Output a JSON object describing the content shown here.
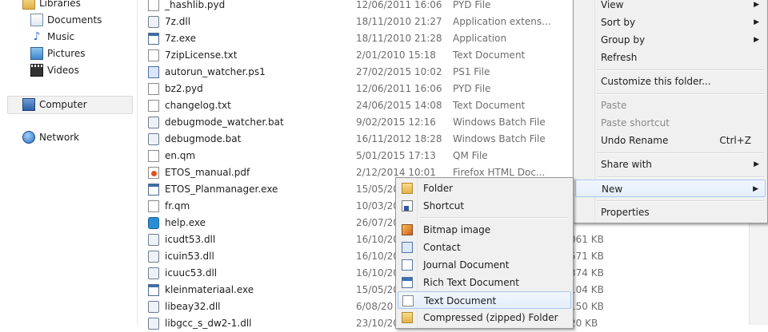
{
  "navigation": {
    "libraries": "Libraries",
    "library_items": [
      {
        "label": "Documents",
        "icon": "documents-icon"
      },
      {
        "label": "Music",
        "icon": "music-icon"
      },
      {
        "label": "Pictures",
        "icon": "pictures-icon"
      },
      {
        "label": "Videos",
        "icon": "videos-icon"
      }
    ],
    "computer": "Computer",
    "network": "Network"
  },
  "files": [
    {
      "name": "_hashlib.pyd",
      "date": "12/06/2011 16:06",
      "type": "PYD File",
      "size": ""
    },
    {
      "name": "7z.dll",
      "date": "18/11/2010 21:27",
      "type": "Application extens...",
      "size": ""
    },
    {
      "name": "7z.exe",
      "date": "18/11/2010 21:28",
      "type": "Application",
      "size": ""
    },
    {
      "name": "7zipLicense.txt",
      "date": "2/01/2010 15:18",
      "type": "Text Document",
      "size": ""
    },
    {
      "name": "autorun_watcher.ps1",
      "date": "27/02/2015 10:02",
      "type": "PS1 File",
      "size": ""
    },
    {
      "name": "bz2.pyd",
      "date": "12/06/2011 16:06",
      "type": "PYD File",
      "size": ""
    },
    {
      "name": "changelog.txt",
      "date": "24/06/2015 14:08",
      "type": "Text Document",
      "size": ""
    },
    {
      "name": "debugmode_watcher.bat",
      "date": "9/02/2015 12:16",
      "type": "Windows Batch File",
      "size": ""
    },
    {
      "name": "debugmode.bat",
      "date": "16/11/2012 18:28",
      "type": "Windows Batch File",
      "size": ""
    },
    {
      "name": "en.qm",
      "date": "5/01/2015 17:13",
      "type": "QM File",
      "size": ""
    },
    {
      "name": "ETOS_manual.pdf",
      "date": "2/12/2014 10:01",
      "type": "Firefox HTML Doc...",
      "size": ""
    },
    {
      "name": "ETOS_Planmanager.exe",
      "date": "15/05/20",
      "type": "",
      "size": ""
    },
    {
      "name": "fr.qm",
      "date": "10/03/20",
      "type": "",
      "size": ""
    },
    {
      "name": "help.exe",
      "date": "26/07/20",
      "type": "",
      "size": ""
    },
    {
      "name": "icudt53.dll",
      "date": "16/10/20",
      "type": "",
      "size": "061 KB"
    },
    {
      "name": "icuin53.dll",
      "date": "16/10/20",
      "type": "",
      "size": "571 KB"
    },
    {
      "name": "icuuc53.dll",
      "date": "16/10/20",
      "type": "",
      "size": "374 KB"
    },
    {
      "name": "kleinmateriaal.exe",
      "date": "15/05/20",
      "type": "",
      "size": "104 KB"
    },
    {
      "name": "libeay32.dll",
      "date": "6/08/20",
      "type": "",
      "size": "150 KB"
    },
    {
      "name": "libgcc_s_dw2-1.dll",
      "date": "23/10/20",
      "type": "",
      "size": "20 KB"
    }
  ],
  "context_menu": {
    "items": [
      {
        "label": "View",
        "arrow": "▶",
        "shortcut": "",
        "disabled": false
      },
      {
        "label": "Sort by",
        "arrow": "▶",
        "shortcut": "",
        "disabled": false
      },
      {
        "label": "Group by",
        "arrow": "▶",
        "shortcut": "",
        "disabled": false
      },
      {
        "label": "Refresh",
        "arrow": "",
        "shortcut": "",
        "disabled": false
      },
      {
        "label": "Customize this folder...",
        "arrow": "",
        "shortcut": "",
        "disabled": false
      },
      {
        "label": "Paste",
        "arrow": "",
        "shortcut": "",
        "disabled": true
      },
      {
        "label": "Paste shortcut",
        "arrow": "",
        "shortcut": "",
        "disabled": true
      },
      {
        "label": "Undo Rename",
        "arrow": "",
        "shortcut": "Ctrl+Z",
        "disabled": false
      },
      {
        "label": "Share with",
        "arrow": "▶",
        "shortcut": "",
        "disabled": false
      },
      {
        "label": "New",
        "arrow": "▶",
        "shortcut": "",
        "disabled": false
      },
      {
        "label": "Properties",
        "arrow": "",
        "shortcut": "",
        "disabled": false
      }
    ]
  },
  "new_submenu": {
    "items": [
      {
        "label": "Folder",
        "icon": "folder-icon"
      },
      {
        "label": "Shortcut",
        "icon": "shortcut-icon"
      },
      {
        "label": "Bitmap image",
        "icon": "bitmap-icon"
      },
      {
        "label": "Contact",
        "icon": "contact-icon"
      },
      {
        "label": "Journal Document",
        "icon": "journal-icon"
      },
      {
        "label": "Rich Text Document",
        "icon": "rich-text-icon"
      },
      {
        "label": "Text Document",
        "icon": "text-document-icon"
      },
      {
        "label": "Compressed (zipped) Folder",
        "icon": "zip-folder-icon"
      }
    ]
  }
}
